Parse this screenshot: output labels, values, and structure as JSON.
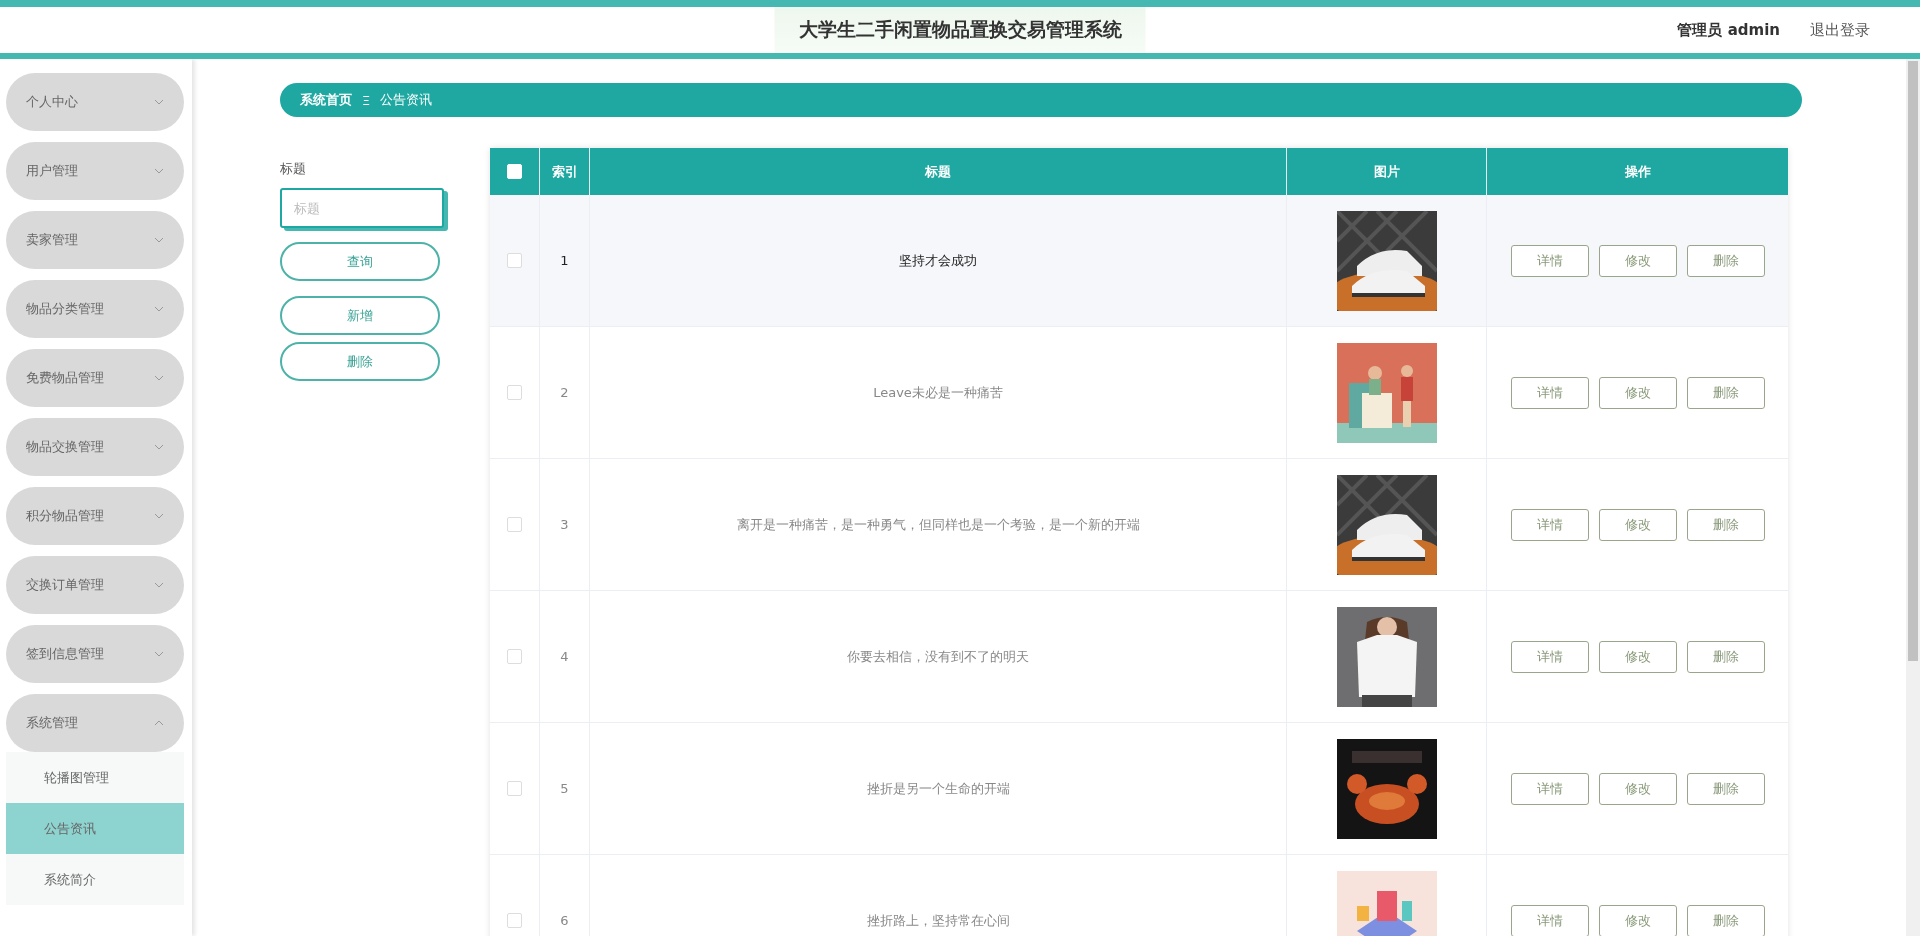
{
  "header": {
    "title": "大学生二手闲置物品置换交易管理系统",
    "user": "管理员 admin",
    "logout": "退出登录"
  },
  "sidebar": {
    "items": [
      {
        "label": "个人中心",
        "expanded": false
      },
      {
        "label": "用户管理",
        "expanded": false
      },
      {
        "label": "卖家管理",
        "expanded": false
      },
      {
        "label": "物品分类管理",
        "expanded": false
      },
      {
        "label": "免费物品管理",
        "expanded": false
      },
      {
        "label": "物品交换管理",
        "expanded": false
      },
      {
        "label": "积分物品管理",
        "expanded": false
      },
      {
        "label": "交换订单管理",
        "expanded": false
      },
      {
        "label": "签到信息管理",
        "expanded": false
      },
      {
        "label": "系统管理",
        "expanded": true,
        "children": [
          {
            "label": "轮播图管理",
            "selected": false
          },
          {
            "label": "公告资讯",
            "selected": true
          },
          {
            "label": "系统简介",
            "selected": false
          }
        ]
      }
    ]
  },
  "breadcrumb": {
    "home": "系统首页",
    "separator": "Ξ",
    "current": "公告资讯"
  },
  "filter": {
    "label": "标题",
    "placeholder": "标题",
    "search_button": "查询",
    "add_button": "新增",
    "delete_button": "删除"
  },
  "table": {
    "columns": [
      "索引",
      "标题",
      "图片",
      "操作"
    ],
    "header_checked": false,
    "rows": [
      {
        "index": "1",
        "title": "坚持才会成功",
        "checked": false,
        "hovered": true,
        "image": {
          "kind": "picture"
        },
        "actions": [
          "详情",
          "修改",
          "删除"
        ]
      },
      {
        "index": "2",
        "title": "Leave未必是一种痛苦",
        "checked": false,
        "hovered": false,
        "image": {
          "kind": "picture"
        },
        "actions": [
          "详情",
          "修改",
          "删除"
        ]
      },
      {
        "index": "3",
        "title": "离开是一种痛苦，是一种勇气，但同样也是一个考验，是一个新的开端",
        "checked": false,
        "hovered": false,
        "image": {
          "kind": "picture"
        },
        "actions": [
          "详情",
          "修改",
          "删除"
        ]
      },
      {
        "index": "4",
        "title": "你要去相信，没有到不了的明天",
        "checked": false,
        "hovered": false,
        "image": {
          "kind": "picture"
        },
        "actions": [
          "详情",
          "修改",
          "删除"
        ]
      },
      {
        "index": "5",
        "title": "挫折是另一个生命的开端",
        "checked": false,
        "hovered": false,
        "image": {
          "kind": "picture"
        },
        "actions": [
          "详情",
          "修改",
          "删除"
        ]
      },
      {
        "index": "6",
        "title": "挫折路上，坚持常在心间",
        "checked": false,
        "hovered": false,
        "image": {
          "kind": "picture"
        },
        "actions": [
          "详情",
          "修改",
          "删除"
        ]
      }
    ]
  }
}
